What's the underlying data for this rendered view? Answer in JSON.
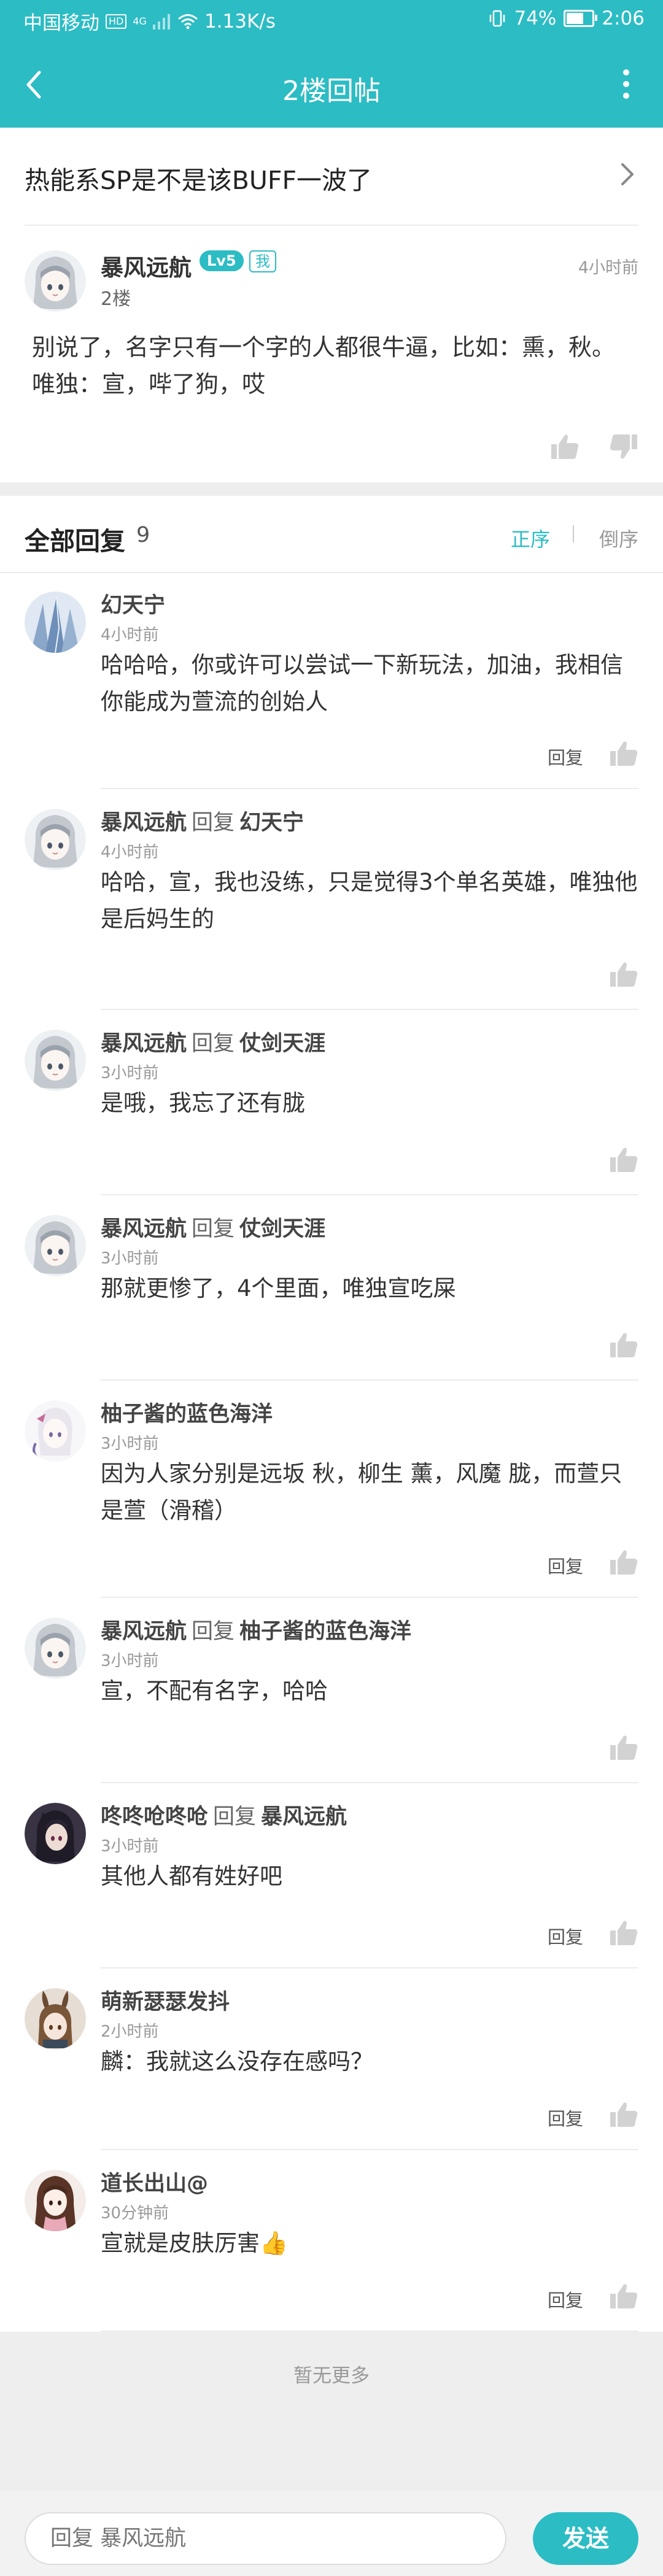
{
  "status_bar": {
    "carrier": "中国移动",
    "hd_badge": "HD",
    "network": "4G",
    "speed": "1.13K/s",
    "battery_percent": "74%",
    "battery_level": 0.74,
    "time": "2:06"
  },
  "app_bar": {
    "title": "2楼回帖",
    "back_icon": "back-arrow-icon",
    "menu_icon": "more-vertical-icon"
  },
  "topic": {
    "title": "热能系SP是不是该BUFF一波了",
    "chevron_icon": "chevron-right-icon"
  },
  "floor": {
    "author": "暴风远航",
    "level": "Lv5",
    "me_tag": "我",
    "time": "4小时前",
    "floor_label": "2楼",
    "content": "别说了，名字只有一个字的人都很牛逼，比如：熏，秋。唯独：宣，哔了狗，哎",
    "like_icon": "thumbs-up-icon",
    "dislike_icon": "thumbs-down-icon"
  },
  "reply_header": {
    "label": "全部回复",
    "count": "9",
    "sort_asc": "正序",
    "sort_desc": "倒序"
  },
  "reply_label": "回复",
  "replies": [
    {
      "author": "幻天宁",
      "reply_word": "",
      "target": "",
      "time": "4小时前",
      "content": "哈哈哈，你或许可以尝试一下新玩法，加油，我相信你能成为萱流的创始人",
      "has_reply_button": true,
      "reply_button": "回复",
      "avatar": "ice"
    },
    {
      "author": "暴风远航",
      "reply_word": "回复",
      "target": "幻天宁",
      "time": "4小时前",
      "content": "哈哈，宣，我也没练，只是觉得3个单名英雄，唯独他是后妈生的",
      "has_reply_button": false,
      "reply_button": "",
      "avatar": "girl"
    },
    {
      "author": "暴风远航",
      "reply_word": "回复",
      "target": "仗剑天涯",
      "time": "3小时前",
      "content": "是哦，我忘了还有胧",
      "has_reply_button": false,
      "reply_button": "",
      "avatar": "girl"
    },
    {
      "author": "暴风远航",
      "reply_word": "回复",
      "target": "仗剑天涯",
      "time": "3小时前",
      "content": "那就更惨了，4个里面，唯独宣吃屎",
      "has_reply_button": false,
      "reply_button": "",
      "avatar": "girl"
    },
    {
      "author": "柚子酱的蓝色海洋",
      "reply_word": "",
      "target": "",
      "time": "3小时前",
      "content": "因为人家分别是远坂 秋，柳生 薰，风魔 胧，而萱只是萱（滑稽）",
      "has_reply_button": true,
      "reply_button": "回复",
      "avatar": "white"
    },
    {
      "author": "暴风远航",
      "reply_word": "回复",
      "target": "柚子酱的蓝色海洋",
      "time": "3小时前",
      "content": "宣，不配有名字，哈哈",
      "has_reply_button": false,
      "reply_button": "",
      "avatar": "girl"
    },
    {
      "author": "咚咚呛咚呛",
      "reply_word": "回复",
      "target": "暴风远航",
      "time": "3小时前",
      "content": "其他人都有姓好吧",
      "has_reply_button": true,
      "reply_button": "回复",
      "avatar": "dark"
    },
    {
      "author": "萌新瑟瑟发抖",
      "reply_word": "",
      "target": "",
      "time": "2小时前",
      "content": "麟：我就这么没存在感吗？",
      "has_reply_button": true,
      "reply_button": "回复",
      "avatar": "bunny"
    },
    {
      "author": "道长出山@",
      "reply_word": "",
      "target": "",
      "time": "30分钟前",
      "content": "宣就是皮肤厉害👍",
      "has_reply_button": true,
      "reply_button": "回复",
      "avatar": "brown"
    }
  ],
  "no_more": "暂无更多",
  "input": {
    "placeholder": "回复 暴风远航",
    "send_label": "发送"
  },
  "colors": {
    "accent": "#2cbcc4",
    "text": "#333333",
    "muted": "#999999",
    "icon_grey": "#d2d2d2"
  }
}
